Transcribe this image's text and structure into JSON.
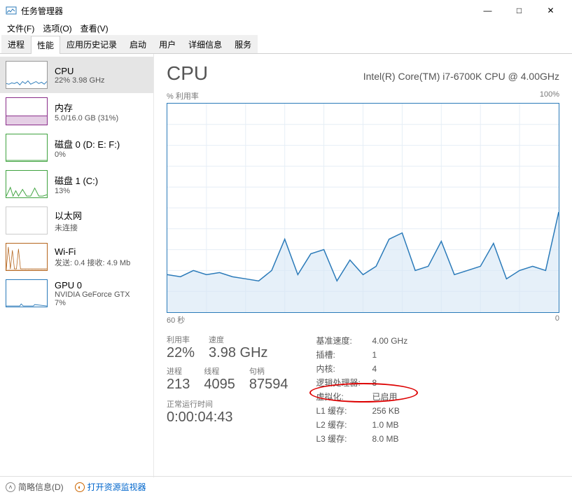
{
  "window": {
    "title": "任务管理器",
    "minimize": "—",
    "maximize": "□",
    "close": "✕"
  },
  "menu": {
    "file": "文件(F)",
    "options": "选项(O)",
    "view": "查看(V)"
  },
  "tabs": {
    "processes": "进程",
    "performance": "性能",
    "app_history": "应用历史记录",
    "startup": "启动",
    "users": "用户",
    "details": "详细信息",
    "services": "服务"
  },
  "sidebar": [
    {
      "title": "CPU",
      "sub": "22% 3.98 GHz",
      "color": "#2a7ab9",
      "type": "cpu"
    },
    {
      "title": "内存",
      "sub": "5.0/16.0 GB (31%)",
      "color": "#8a2d8a",
      "type": "mem"
    },
    {
      "title": "磁盘 0 (D: E: F:)",
      "sub": "0%",
      "color": "#3fa33f",
      "type": "disk0"
    },
    {
      "title": "磁盘 1 (C:)",
      "sub": "13%",
      "color": "#3fa33f",
      "type": "disk1"
    },
    {
      "title": "以太网",
      "sub": "未连接",
      "color": "#999",
      "type": "eth"
    },
    {
      "title": "Wi-Fi",
      "sub": "发送: 0.4 接收: 4.9 Mb",
      "color": "#b5651d",
      "type": "wifi"
    },
    {
      "title": "GPU 0",
      "sub": "NVIDIA GeForce GTX\n7%",
      "color": "#2a7ab9",
      "type": "gpu"
    }
  ],
  "detail": {
    "title": "CPU",
    "model": "Intel(R) Core(TM) i7-6700K CPU @ 4.00GHz",
    "util_label": "% 利用率",
    "util_max": "100%",
    "x_left": "60 秒",
    "x_right": "0"
  },
  "stats_left": {
    "util_label": "利用率",
    "util_value": "22%",
    "speed_label": "速度",
    "speed_value": "3.98 GHz",
    "proc_label": "进程",
    "proc_value": "213",
    "thread_label": "线程",
    "thread_value": "4095",
    "handle_label": "句柄",
    "handle_value": "87594",
    "uptime_label": "正常运行时间",
    "uptime_value": "0:00:04:43"
  },
  "stats_right": {
    "base_k": "基准速度:",
    "base_v": "4.00 GHz",
    "sockets_k": "插槽:",
    "sockets_v": "1",
    "cores_k": "内核:",
    "cores_v": "4",
    "lproc_k": "逻辑处理器:",
    "lproc_v": "8",
    "virt_k": "虚拟化:",
    "virt_v": "已启用",
    "l1_k": "L1 缓存:",
    "l1_v": "256 KB",
    "l2_k": "L2 缓存:",
    "l2_v": "1.0 MB",
    "l3_k": "L3 缓存:",
    "l3_v": "8.0 MB"
  },
  "footer": {
    "fewer": "简略信息(D)",
    "resmon": "打开资源监视器"
  },
  "chart_data": {
    "type": "line",
    "title": "% 利用率",
    "xlabel": "60 秒 → 0",
    "ylabel": "% 利用率",
    "ylim": [
      0,
      100
    ],
    "x_seconds": [
      60,
      58,
      56,
      54,
      52,
      50,
      48,
      46,
      44,
      42,
      40,
      38,
      36,
      34,
      32,
      30,
      28,
      26,
      24,
      22,
      20,
      18,
      16,
      14,
      12,
      10,
      8,
      6,
      4,
      2,
      0
    ],
    "values_pct": [
      18,
      17,
      20,
      18,
      19,
      17,
      16,
      15,
      20,
      35,
      18,
      28,
      30,
      15,
      25,
      18,
      22,
      35,
      38,
      20,
      22,
      34,
      18,
      20,
      22,
      33,
      16,
      20,
      22,
      20,
      48
    ]
  }
}
